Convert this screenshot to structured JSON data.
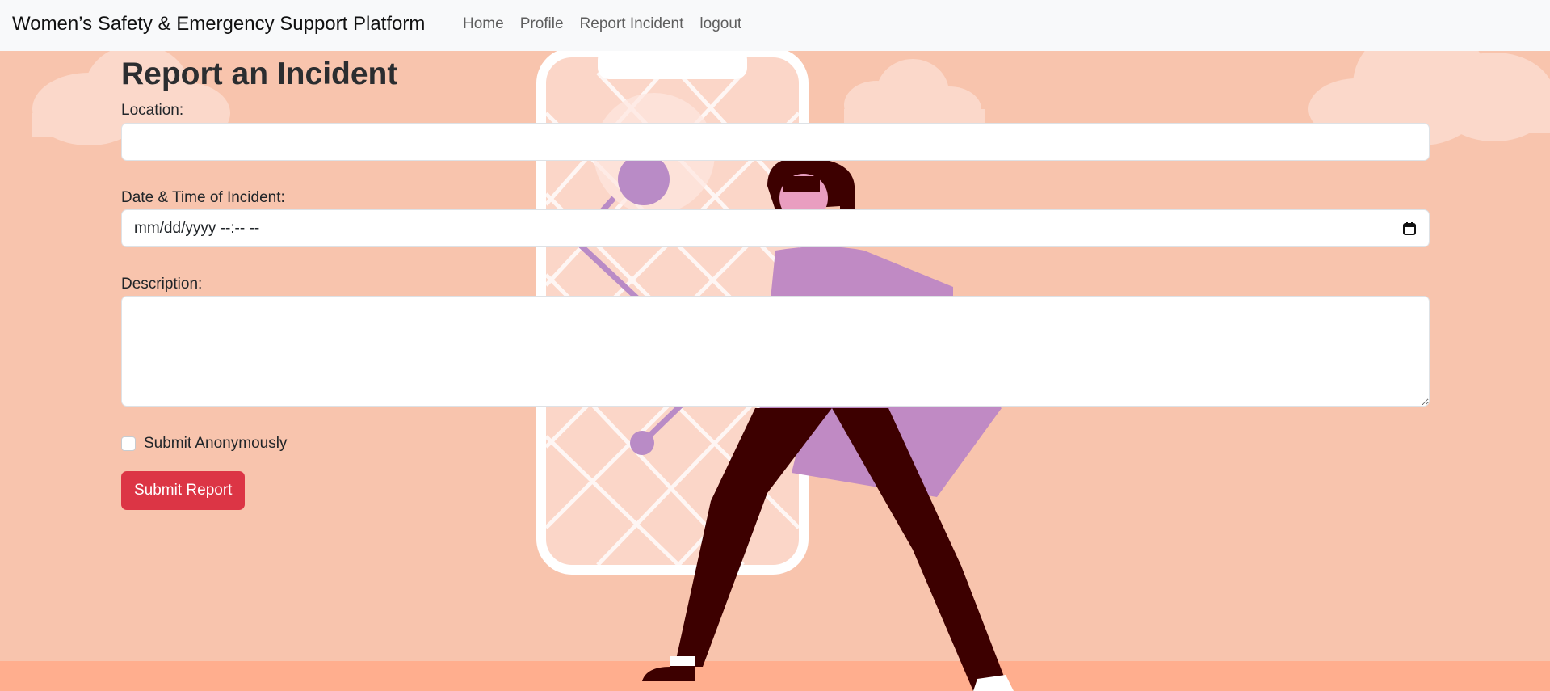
{
  "navbar": {
    "brand": "Women’s Safety & Emergency Support Platform",
    "links": [
      {
        "label": "Home"
      },
      {
        "label": "Profile"
      },
      {
        "label": "Report Incident"
      },
      {
        "label": "logout"
      }
    ]
  },
  "form": {
    "title": "Report an Incident",
    "location_label": "Location:",
    "location_value": "",
    "datetime_label": "Date & Time of Incident:",
    "datetime_placeholder": "mm/dd/yyyy --:-- --",
    "description_label": "Description:",
    "description_value": "",
    "anonymous_label": "Submit Anonymously",
    "anonymous_checked": false,
    "submit_label": "Submit Report"
  },
  "colors": {
    "background": "#f8c4ad",
    "navbar": "#f8f9fa",
    "submit_button": "#dc3545",
    "figure_hair_pants": "#3d0000",
    "figure_coat": "#c08ac4",
    "figure_shirt": "#e99ec0",
    "map_pin": "#b98bc6"
  }
}
